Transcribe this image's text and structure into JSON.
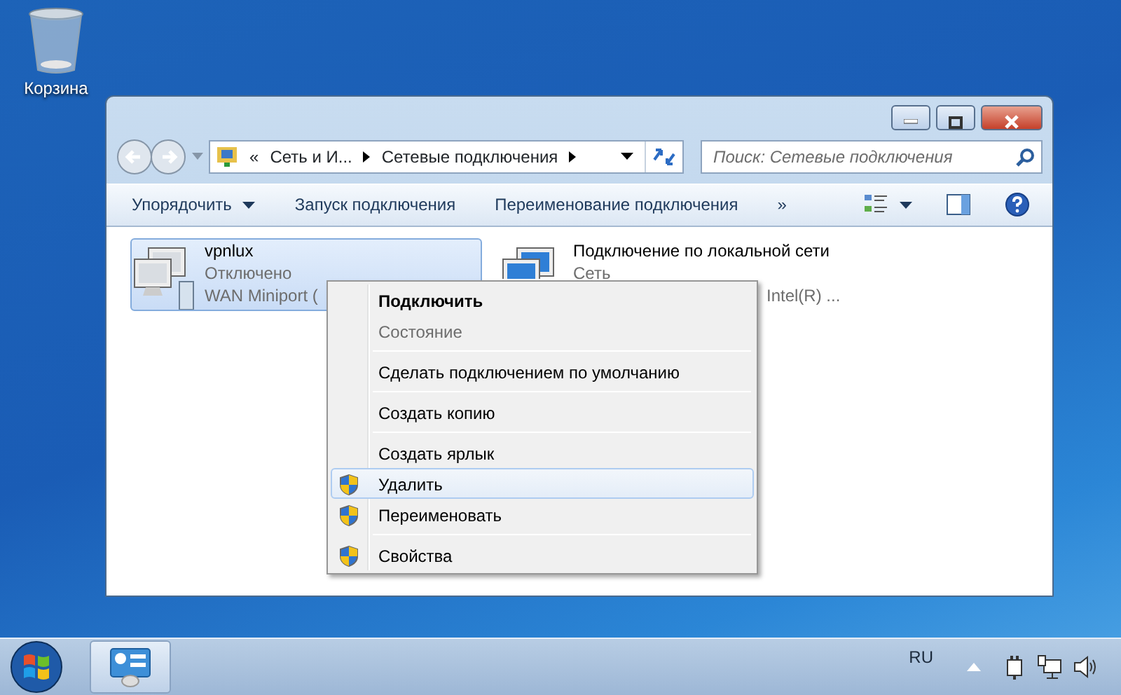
{
  "desktop": {
    "icons": [
      {
        "label": "Корзина"
      }
    ]
  },
  "window": {
    "address": {
      "overflow": "«",
      "crumbs": [
        "Сеть и И...",
        "Сетевые подключения"
      ]
    },
    "search": {
      "placeholder": "Поиск: Сетевые подключения"
    },
    "toolbar": [
      {
        "label": "Упорядочить",
        "kind": "menu"
      },
      {
        "label": "Запуск подключения",
        "kind": "button"
      },
      {
        "label": "Переименование подключения",
        "kind": "button"
      },
      {
        "label": "»",
        "kind": "button"
      }
    ],
    "connections": [
      {
        "kind": "wan",
        "name": "vpnlux",
        "status": "Отключено",
        "device": "WAN Miniport (",
        "selected": true
      },
      {
        "kind": "lan",
        "name": "Подключение по локальной сети",
        "status": "Сеть",
        "device": "Intel(R) ...",
        "selected": false
      }
    ]
  },
  "context_menu": [
    {
      "kind": "item",
      "label": "Подключить",
      "default": true,
      "disabled": false,
      "shield": false,
      "selected": false
    },
    {
      "kind": "item",
      "label": "Состояние",
      "default": false,
      "disabled": true,
      "shield": false,
      "selected": false
    },
    {
      "kind": "separator"
    },
    {
      "kind": "item",
      "label": "Сделать подключением по умолчанию",
      "default": false,
      "disabled": false,
      "shield": false,
      "selected": false
    },
    {
      "kind": "separator"
    },
    {
      "kind": "item",
      "label": "Создать копию",
      "default": false,
      "disabled": false,
      "shield": false,
      "selected": false
    },
    {
      "kind": "separator"
    },
    {
      "kind": "item",
      "label": "Создать ярлык",
      "default": false,
      "disabled": false,
      "shield": false,
      "selected": false
    },
    {
      "kind": "item",
      "label": "Удалить",
      "default": false,
      "disabled": false,
      "shield": true,
      "selected": true
    },
    {
      "kind": "item",
      "label": "Переименовать",
      "default": false,
      "disabled": false,
      "shield": true,
      "selected": false
    },
    {
      "kind": "separator"
    },
    {
      "kind": "item",
      "label": "Свойства",
      "default": false,
      "disabled": false,
      "shield": true,
      "selected": false
    }
  ],
  "taskbar": {
    "language": "RU"
  }
}
